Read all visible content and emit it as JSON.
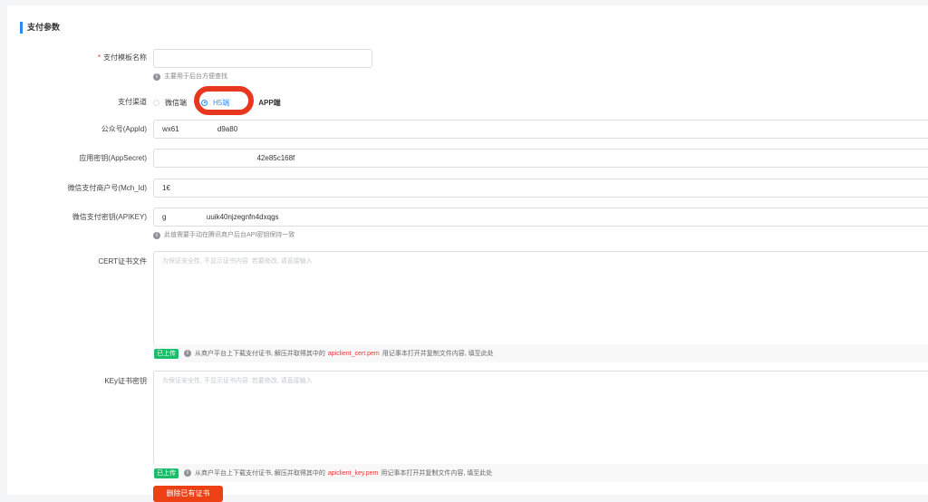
{
  "section": {
    "title": "支付参数"
  },
  "template_name": {
    "label": "支付模板名称",
    "required_mark": "*",
    "value": "",
    "hint": "主要用于后台方便查找"
  },
  "channel": {
    "label": "支付渠道",
    "options": [
      {
        "label": "微信端",
        "checked": false
      },
      {
        "label": "H5端",
        "checked": true
      },
      {
        "label": "APP端",
        "checked": false
      }
    ]
  },
  "appid": {
    "label": "公众号(AppId)",
    "value": "wx61                   d9a80"
  },
  "appsecret": {
    "label": "应用密钥(AppSecret)",
    "value": "                                               42e85c168f"
  },
  "mch_id": {
    "label": "微信支付商户号(Mch_Id)",
    "value": "1€"
  },
  "apikey": {
    "label": "微信支付密钥(APIKEY)",
    "value": "g                    uuik40njzegnfn4dxqgs",
    "hint": "此值需要手动在腾讯商户后台API密钥保持一致"
  },
  "cert": {
    "label": "CERT证书文件",
    "placeholder": "为保证安全性, 不显示证书内容. 若要修改, 请直接输入",
    "badge": "已上传",
    "hint_prefix": "从商户平台上下载支付证书, 解压并取得其中的",
    "file": "apiclient_cert.pem",
    "hint_suffix": "用记事本打开并复制文件内容, 填至此处"
  },
  "key": {
    "label": "KEy证书密钥",
    "placeholder": "为保证安全性, 不显示证书内容. 若要修改, 请直接输入",
    "badge": "已上传",
    "hint_prefix": "从商户平台上下载支付证书, 解压并取得其中的",
    "file": "apiclient_key.pem",
    "hint_suffix": "用记事本打开并复制文件内容, 填至此处"
  },
  "delete_button": {
    "label": "删除已有证书"
  },
  "colors": {
    "accent": "#2d8cf0",
    "danger": "#e53935",
    "success": "#19be6b",
    "highlight": "#e8371f"
  }
}
